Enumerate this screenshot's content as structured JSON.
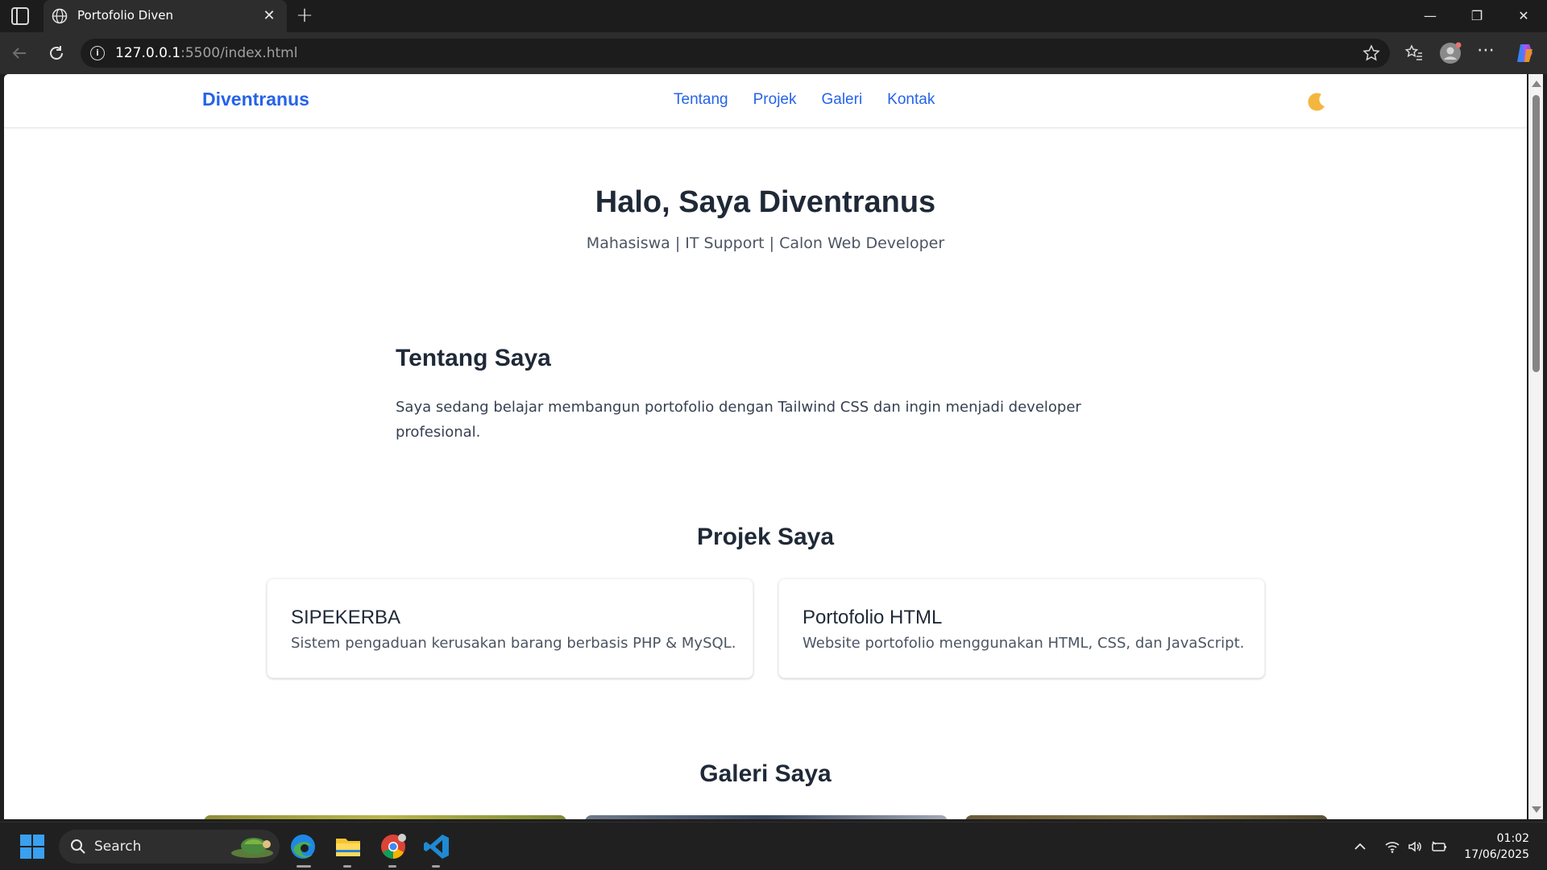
{
  "browser": {
    "tab_title": "Portofolio Diven",
    "url_host": "127.0.0.1",
    "url_rest": ":5500/index.html"
  },
  "site": {
    "brand": "Diventranus",
    "nav": [
      "Tentang",
      "Projek",
      "Galeri",
      "Kontak"
    ],
    "theme_toggle_icon": "moon-icon"
  },
  "hero": {
    "title": "Halo, Saya Diventranus",
    "subtitle": "Mahasiswa | IT Support | Calon Web Developer"
  },
  "about": {
    "title": "Tentang Saya",
    "text": "Saya sedang belajar membangun portofolio dengan Tailwind CSS dan ingin menjadi developer profesional."
  },
  "projects": {
    "title": "Projek Saya",
    "items": [
      {
        "name": "SIPEKERBA",
        "desc": "Sistem pengaduan kerusakan barang berbasis PHP & MySQL."
      },
      {
        "name": "Portofolio HTML",
        "desc": "Website portofolio menggunakan HTML, CSS, dan JavaScript."
      }
    ]
  },
  "gallery": {
    "title": "Galeri Saya"
  },
  "taskbar": {
    "search_label": "Search",
    "time": "01:02",
    "date": "17/06/2025"
  },
  "colors": {
    "accent": "#2563eb",
    "heading": "#1f2937"
  }
}
